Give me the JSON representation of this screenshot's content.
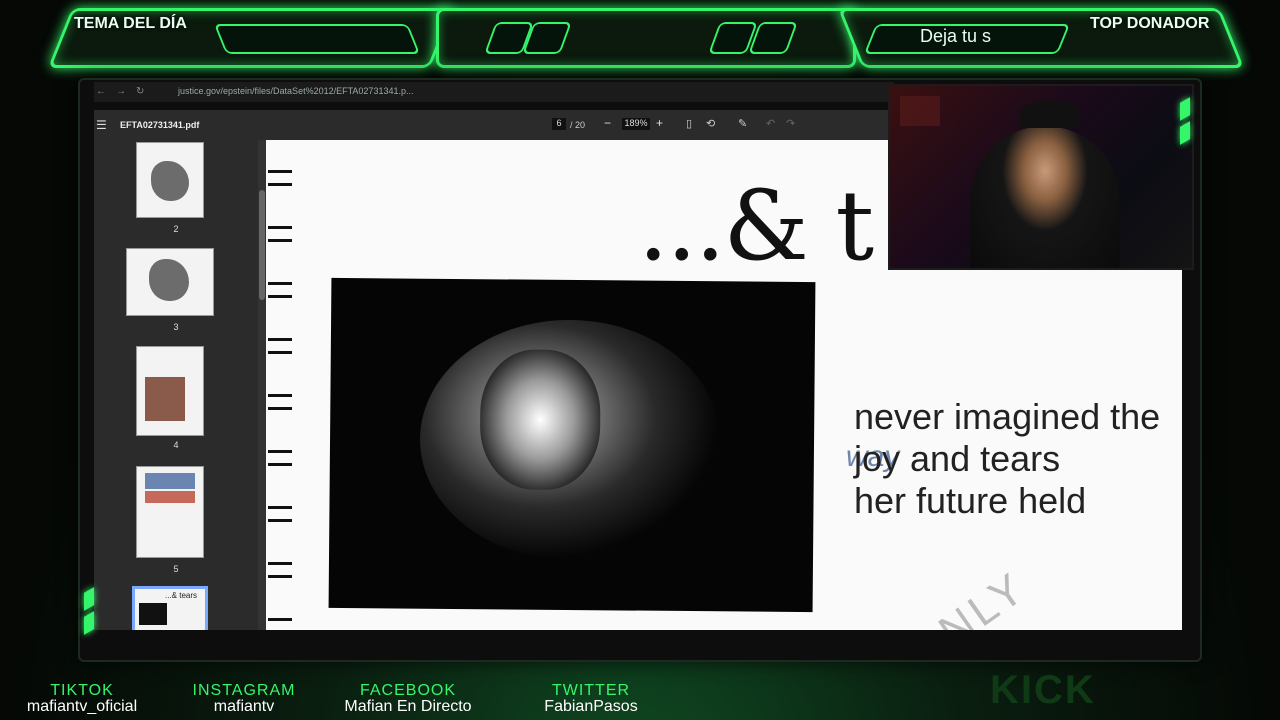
{
  "overlay": {
    "left_title": "TEMA DEL DÍA",
    "right_title": "TOP DONADOR",
    "right_slot_text": "Deja tu s",
    "accent_color": "#35f56a"
  },
  "browser": {
    "url": "justice.gov/epstein/files/DataSet%2012/EFTA02731341.p..."
  },
  "pdf_toolbar": {
    "file_name": "EFTA02731341.pdf",
    "page_current": "6",
    "page_total": "/ 20",
    "zoom": "189%"
  },
  "thumbnails": [
    {
      "num": "2"
    },
    {
      "num": "3"
    },
    {
      "num": "4"
    },
    {
      "num": "5"
    },
    {
      "num": "6",
      "caption": "...& tears"
    }
  ],
  "document": {
    "heading": "...& t",
    "line1": "never imagined the",
    "line2": "joy and tears",
    "line3": "her future held",
    "scribble": "way",
    "watermark": "NLY"
  },
  "socials": [
    {
      "label": "TIKTOK",
      "handle": "mafiantv_oficial"
    },
    {
      "label": "INSTAGRAM",
      "handle": "mafiantv"
    },
    {
      "label": "FACEBOOK",
      "handle": "Mafian En Directo"
    },
    {
      "label": "TWITTER",
      "handle": "FabianPasos"
    }
  ],
  "brand": "KICK"
}
